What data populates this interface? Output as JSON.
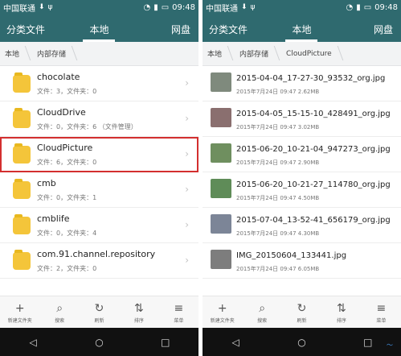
{
  "left": {
    "status": {
      "carrier": "中国联通",
      "time": "09:48"
    },
    "header": {
      "left": "分类文件",
      "center": "本地",
      "right": "网盘"
    },
    "breadcrumb": [
      "本地",
      "内部存储"
    ],
    "folders": [
      {
        "name": "chocolate",
        "meta": "文件：3，文件夹：0"
      },
      {
        "name": "CloudDrive",
        "meta": "文件：0，文件夹：6 （文件管理）"
      },
      {
        "name": "CloudPicture",
        "meta": "文件：6，文件夹：0",
        "selected": true
      },
      {
        "name": "cmb",
        "meta": "文件：0，文件夹：1"
      },
      {
        "name": "cmblife",
        "meta": "文件：0，文件夹：4"
      },
      {
        "name": "com.91.channel.repository",
        "meta": "文件：2，文件夹：0"
      }
    ],
    "toolbar": [
      "新建文件夹",
      "搜索",
      "刷新",
      "排序",
      "菜单"
    ]
  },
  "right": {
    "status": {
      "carrier": "中国联通",
      "time": "09:48"
    },
    "header": {
      "left": "分类文件",
      "center": "本地",
      "right": "网盘"
    },
    "breadcrumb": [
      "本地",
      "内部存储",
      "CloudPicture"
    ],
    "files": [
      {
        "name": "2015-04-04_17-27-30_93532_org.jpg",
        "meta": "2015年7月24日 09:47 2.62MB"
      },
      {
        "name": "2015-04-05_15-15-10_428491_org.jpg",
        "meta": "2015年7月24日 09:47 3.02MB"
      },
      {
        "name": "2015-06-20_10-21-04_947273_org.jpg",
        "meta": "2015年7月24日 09:47 2.90MB"
      },
      {
        "name": "2015-06-20_10-21-27_114780_org.jpg",
        "meta": "2015年7月24日 09:47 4.50MB"
      },
      {
        "name": "2015-07-04_13-52-41_656179_org.jpg",
        "meta": "2015年7月24日 09:47 4.30MB"
      },
      {
        "name": "IMG_20150604_133441.jpg",
        "meta": "2015年7月24日 09:47 6.05MB"
      }
    ],
    "toolbar": [
      "新建文件夹",
      "搜索",
      "刷新",
      "排序",
      "菜单"
    ]
  }
}
